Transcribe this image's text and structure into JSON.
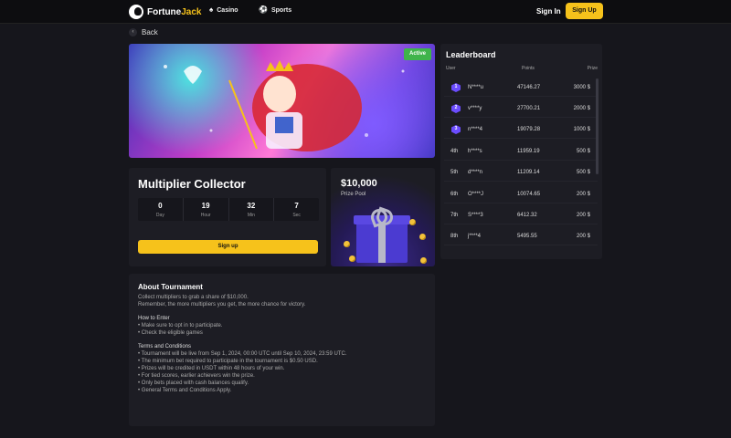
{
  "header": {
    "logo_text_a": "Fortune",
    "logo_text_b": "Jack",
    "nav": [
      {
        "label": "Casino",
        "icon": "casino-icon"
      },
      {
        "label": "Sports",
        "icon": "sports-icon"
      }
    ],
    "signin_label": "Sign In",
    "signup_label": "Sign Up"
  },
  "back_label": "Back",
  "banner": {
    "status": "Active"
  },
  "tournament": {
    "name": "Multiplier Collector",
    "countdown": [
      {
        "value": "0",
        "unit": "Day"
      },
      {
        "value": "19",
        "unit": "Hour"
      },
      {
        "value": "32",
        "unit": "Min"
      },
      {
        "value": "7",
        "unit": "Sec"
      }
    ],
    "signup_label": "Sign up"
  },
  "prize": {
    "amount": "$10,000",
    "label": "Prize Pool"
  },
  "leaderboard": {
    "title": "Leaderboard",
    "columns": [
      "User",
      "Points",
      "Prize"
    ],
    "rows": [
      {
        "rank": "1",
        "user": "N****u",
        "points": "47146.27",
        "prize": "3000 $"
      },
      {
        "rank": "2",
        "user": "v****y",
        "points": "27700.21",
        "prize": "2000 $"
      },
      {
        "rank": "3",
        "user": "n****4",
        "points": "19079.28",
        "prize": "1000 $"
      },
      {
        "rank": "4th",
        "user": "h****s",
        "points": "11959.19",
        "prize": "500 $"
      },
      {
        "rank": "5th",
        "user": "d****n",
        "points": "11209.14",
        "prize": "500 $"
      },
      {
        "rank": "6th",
        "user": "O****J",
        "points": "10074.65",
        "prize": "200 $"
      },
      {
        "rank": "7th",
        "user": "S****3",
        "points": "6412.32",
        "prize": "200 $"
      },
      {
        "rank": "8th",
        "user": "j****4",
        "points": "5495.55",
        "prize": "200 $"
      }
    ]
  },
  "about": {
    "title": "About Tournament",
    "intro": [
      "Collect multipliers to grab a share of $10,000.",
      "Remember, the more multipliers you get, the more chance for victory."
    ],
    "how_title": "How to Enter",
    "how_items": [
      "Make sure to opt in to participate.",
      "Check the eligible games"
    ],
    "terms_title": "Terms and Conditions",
    "terms_items": [
      "Tournament will be live from Sep 1, 2024, 00:00 UTC until Sep 10, 2024, 23:59 UTC.",
      "The minimum bet required to participate in the tournament is $0.50 USD.",
      "Prizes will be credited in USDT within 48 hours of your win.",
      "For tied scores, earlier achievers win the prize.",
      "Only bets placed with cash balances qualify.",
      "General Terms and Conditions Apply."
    ]
  }
}
